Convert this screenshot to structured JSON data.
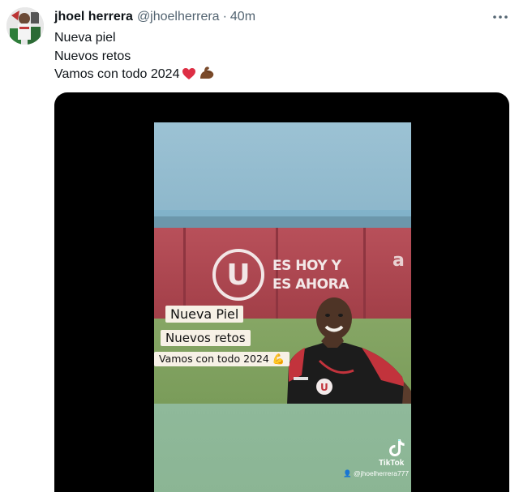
{
  "tweet": {
    "display_name": "jhoel herrera",
    "handle": "@jhoelherrera",
    "separator": "·",
    "time": "40m",
    "lines": [
      "Nueva piel",
      "Nuevos retos",
      "Vamos con todo 2024"
    ]
  },
  "icons": {
    "more": "more-dots-icon",
    "heart": "red-heart-emoji",
    "arm": "flexed-biceps-emoji",
    "tiktok": "tiktok-logo-icon"
  },
  "video": {
    "banner_logo_letter": "U",
    "banner_slogan": [
      "ES HOY Y",
      "ES AHORA"
    ],
    "banner_edge_text": "a",
    "sticker_lines": [
      "Nueva Piel",
      "Nuevos retos",
      "Vamos con todo 2024"
    ],
    "watermark_label": "TikTok",
    "watermark_user": "@jhoelherrera777"
  },
  "colors": {
    "heart": "#dd2e44",
    "arm": "#7a4a2a",
    "media_bg": "#000000",
    "banner": "#a94550"
  }
}
